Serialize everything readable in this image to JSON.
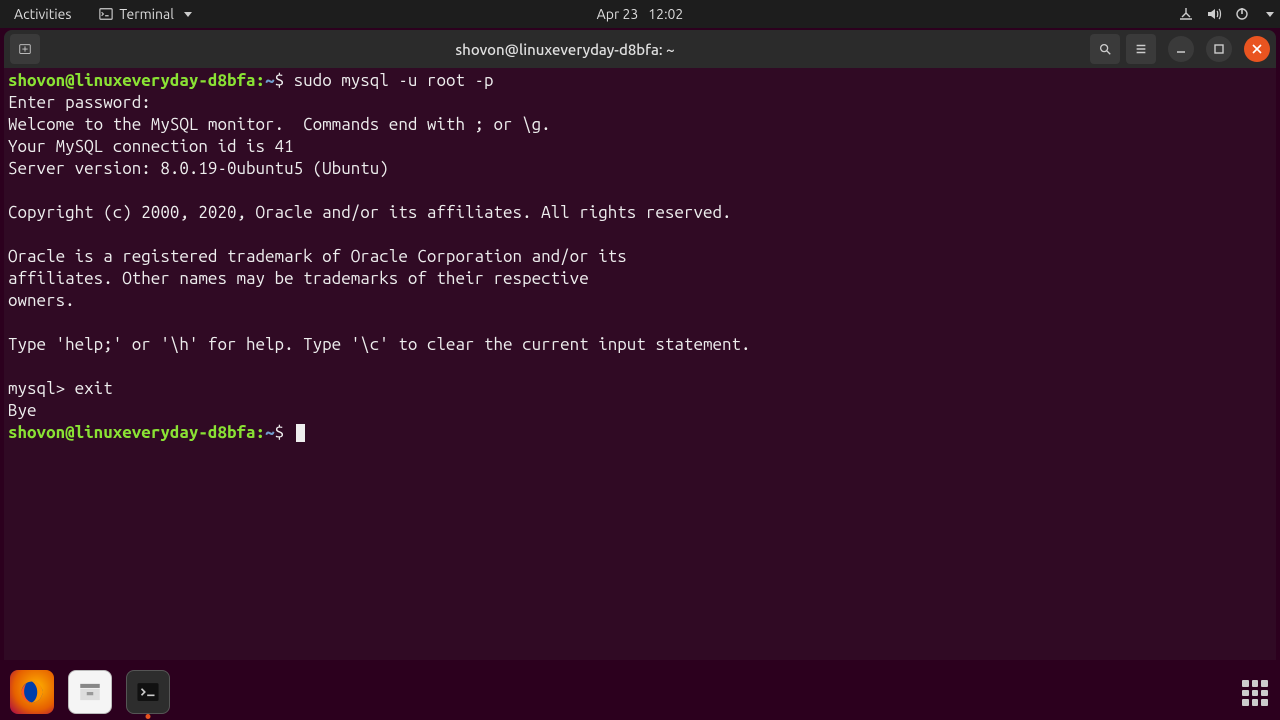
{
  "topbar": {
    "activities": "Activities",
    "app_name": "Terminal",
    "date": "Apr 23",
    "time": "12:02"
  },
  "window": {
    "title": "shovon@linuxeveryday-d8bfa: ~"
  },
  "terminal": {
    "prompt1_user": "shovon@linuxeveryday-d8bfa",
    "prompt1_path": "~",
    "prompt1_symbol": "$",
    "cmd1": "sudo mysql -u root -p",
    "lines": [
      "Enter password:",
      "Welcome to the MySQL monitor.  Commands end with ; or \\g.",
      "Your MySQL connection id is 41",
      "Server version: 8.0.19-0ubuntu5 (Ubuntu)",
      "",
      "Copyright (c) 2000, 2020, Oracle and/or its affiliates. All rights reserved.",
      "",
      "Oracle is a registered trademark of Oracle Corporation and/or its",
      "affiliates. Other names may be trademarks of their respective",
      "owners.",
      "",
      "Type 'help;' or '\\h' for help. Type '\\c' to clear the current input statement.",
      "",
      "mysql> exit",
      "Bye"
    ],
    "prompt2_user": "shovon@linuxeveryday-d8bfa",
    "prompt2_path": "~",
    "prompt2_symbol": "$"
  }
}
